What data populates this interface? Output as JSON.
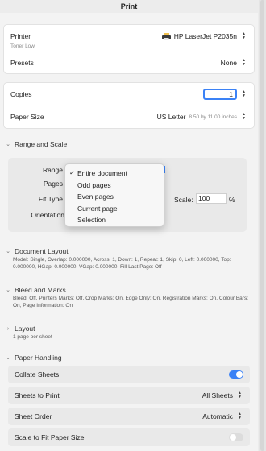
{
  "window": {
    "title": "Print"
  },
  "printer": {
    "label": "Printer",
    "value": "HP LaserJet P2035n",
    "status": "Toner Low"
  },
  "presets": {
    "label": "Presets",
    "value": "None"
  },
  "copies": {
    "label": "Copies",
    "value": "1"
  },
  "paper_size": {
    "label": "Paper Size",
    "value": "US Letter",
    "dims": "8.50 by 11.00 inches"
  },
  "range_scale": {
    "header": "Range and Scale",
    "range_label": "Range",
    "pages_label": "Pages",
    "fit_type_label": "Fit Type",
    "orientation_label": "Orientation",
    "scale_label": "Scale:",
    "scale_value": "100",
    "scale_unit": "%",
    "range_options": [
      {
        "label": "Entire document",
        "checked": "✓"
      },
      {
        "label": "Odd pages",
        "checked": ""
      },
      {
        "label": "Even pages",
        "checked": ""
      },
      {
        "label": "Current page",
        "checked": ""
      },
      {
        "label": "Selection",
        "checked": ""
      }
    ]
  },
  "document_layout": {
    "header": "Document Layout",
    "summary": "Model: Single, Overlap: 0.000000, Across: 1, Down: 1, Repeat: 1, Skip: 0, Left: 0.000000, Top: 0.000000, HGap: 0.000000, VGap: 0.000000, Fill Last Page: Off"
  },
  "bleed_marks": {
    "header": "Bleed and Marks",
    "summary": "Bleed: Off, Printers Marks: Off, Crop Marks: On, Edge Only: On, Registration Marks: On, Colour Bars: On, Page Information: On"
  },
  "layout": {
    "header": "Layout",
    "summary": "1 page per sheet"
  },
  "paper_handling": {
    "header": "Paper Handling",
    "collate": {
      "label": "Collate Sheets",
      "state": "on"
    },
    "sheets_to_print": {
      "label": "Sheets to Print",
      "value": "All Sheets"
    },
    "sheet_order": {
      "label": "Sheet Order",
      "value": "Automatic"
    },
    "scale_to_fit": {
      "label": "Scale to Fit Paper Size",
      "state": "off"
    }
  },
  "colors": {
    "accent": "#3b82f6",
    "toggle_off": "#dcdcdc"
  },
  "icons": {
    "stepper": "stepper-icon",
    "chevron_down": "chevron-down-icon",
    "chevron_right": "chevron-right-icon",
    "printer": "printer-icon",
    "check": "checkmark-icon"
  }
}
